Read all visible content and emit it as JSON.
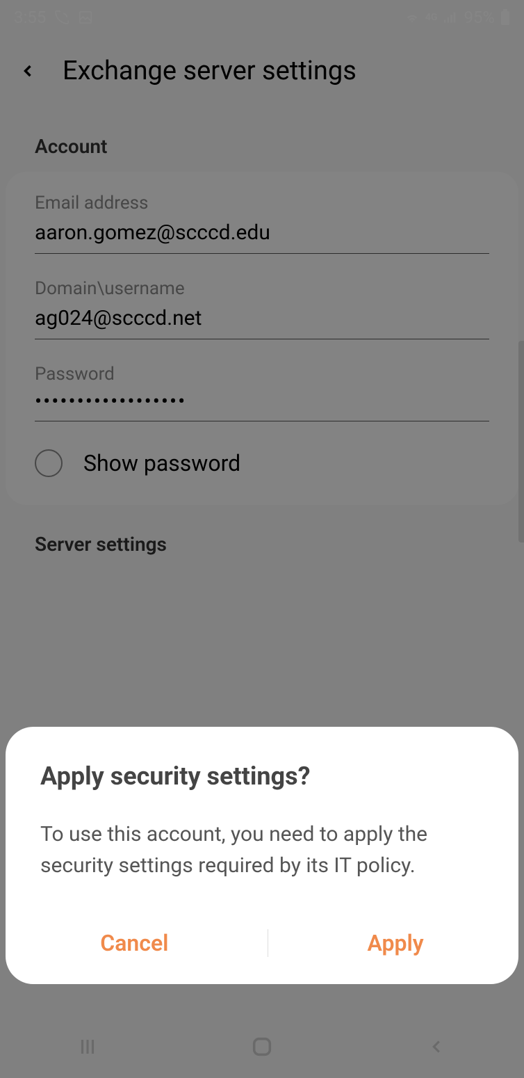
{
  "status": {
    "time": "3:55",
    "battery": "95%"
  },
  "header": {
    "title": "Exchange server settings"
  },
  "sections": {
    "account_label": "Account",
    "server_label": "Server settings"
  },
  "fields": {
    "email": {
      "label": "Email address",
      "value": "aaron.gomez@scccd.edu"
    },
    "domain": {
      "label": "Domain\\username",
      "value": "ag024@scccd.net"
    },
    "password": {
      "label": "Password",
      "value": "••••••••••••••••••"
    },
    "show_password_label": "Show password"
  },
  "dialog": {
    "title": "Apply security settings?",
    "body": "To use this account, you need to apply the security settings required by its IT policy.",
    "cancel": "Cancel",
    "apply": "Apply"
  },
  "colors": {
    "accent": "#f08a4b"
  }
}
